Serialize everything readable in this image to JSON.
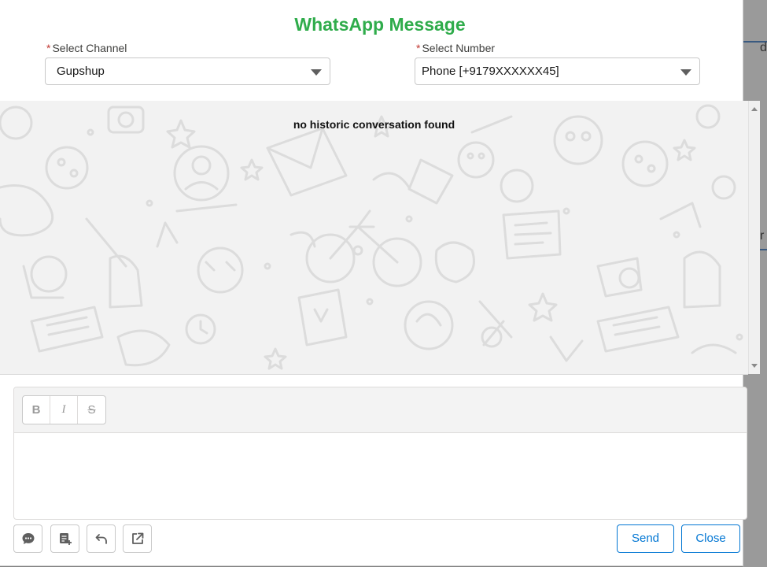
{
  "modal": {
    "title": "WhatsApp Message"
  },
  "channel": {
    "required_marker": "*",
    "label": "Select Channel",
    "value": "Gupshup"
  },
  "number": {
    "required_marker": "*",
    "label": "Select Number",
    "value": "Phone [+9179XXXXXX45]"
  },
  "conversation": {
    "empty_message": "no historic conversation found"
  },
  "editor": {
    "bold_label": "B",
    "italic_label": "I",
    "strike_label": "S",
    "content": ""
  },
  "actions": {
    "icons": [
      "chat-bubble-icon",
      "template-add-icon",
      "undo-icon",
      "new-window-icon"
    ],
    "send_label": "Send",
    "close_label": "Close"
  },
  "backdrop": {
    "fragment_top": "d",
    "fragment_mid": "r"
  },
  "colors": {
    "title_green": "#2fac4b",
    "brand_blue": "#0176d3",
    "required_red": "#c23934"
  }
}
